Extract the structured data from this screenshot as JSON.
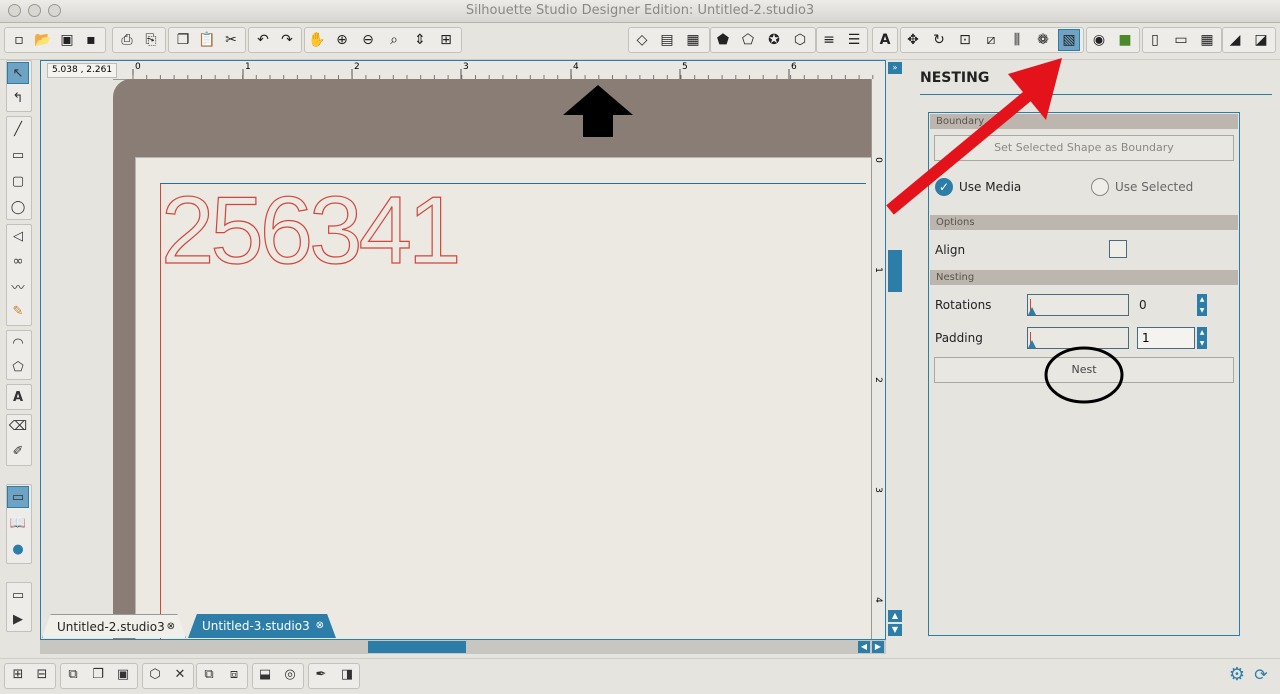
{
  "window": {
    "title": "Silhouette Studio Designer Edition: Untitled-2.studio3"
  },
  "toolbar": {
    "file_icons": [
      "new-document-icon",
      "open-folder-icon",
      "save-icon",
      "save-to-library-icon",
      "print-icon",
      "print-cut-icon",
      "copy-icon",
      "paste-icon",
      "cut-icon",
      "undo-icon",
      "redo-icon",
      "pan-hand-icon",
      "zoom-in-icon",
      "zoom-out-icon",
      "zoom-select-icon",
      "zoom-drag-icon",
      "fit-page-icon"
    ],
    "right_icons": [
      "design-page-icon",
      "page-settings-icon",
      "grid-icon",
      "fill-color-icon",
      "line-color-icon",
      "gradient-icon",
      "fill-pattern-icon",
      "line-style-icon",
      "line-width-icon",
      "text-style-icon",
      "transform-icon",
      "rotate-icon",
      "scale-icon",
      "shear-icon",
      "align-icon",
      "replicate-icon",
      "nesting-icon",
      "offset-icon",
      "trace-icon",
      "cut-settings-icon",
      "media-icon",
      "library-icon",
      "grid-view-icon",
      "eraser-knife-icon",
      "send-to-cutter-icon"
    ]
  },
  "tools": [
    "select-tool-icon",
    "point-edit-icon",
    "line-tool-icon",
    "rectangle-tool-icon",
    "rounded-rectangle-tool-icon",
    "ellipse-tool-icon",
    "polygon-tool-icon",
    "curve-tool-icon",
    "freehand-tool-icon",
    "smooth-freehand-icon",
    "arc-tool-icon",
    "regular-polygon-icon",
    "text-tool-icon",
    "eraser-tool-icon",
    "knife-tool-icon",
    "design-view-icon",
    "library-view-icon",
    "store-icon",
    "preview-icon",
    "play-icon"
  ],
  "canvas": {
    "coords": "5.038 , 2.261",
    "ruler_top_numbers": [
      "0",
      "1",
      "2",
      "3",
      "4",
      "5",
      "6"
    ],
    "ruler_right_numbers": [
      "0",
      "1",
      "2",
      "3",
      "4"
    ],
    "design_text": "256341",
    "design_color": "#d0463a"
  },
  "tabs": [
    {
      "label": "Untitled-2.studio3",
      "active": false
    },
    {
      "label": "Untitled-3.studio3",
      "active": true
    }
  ],
  "panel": {
    "title": "NESTING",
    "boundary": {
      "section": "Boundary",
      "set_button": "Set Selected Shape as Boundary",
      "use_media": "Use Media",
      "use_selected": "Use Selected",
      "selected": "use_media"
    },
    "options": {
      "section": "Options",
      "align_label": "Align",
      "align_checked": false
    },
    "nesting": {
      "section": "Nesting",
      "rotations_label": "Rotations",
      "rotations_value": "0",
      "padding_label": "Padding",
      "padding_value": "1",
      "nest_button": "Nest"
    }
  },
  "annotations": {
    "red_arrow_color": "#e3121b",
    "black_arrow_color": "#000000"
  },
  "colors": {
    "accent": "#2c7ea8",
    "mat": "#8a7d75",
    "paper": "#ece9e3"
  }
}
